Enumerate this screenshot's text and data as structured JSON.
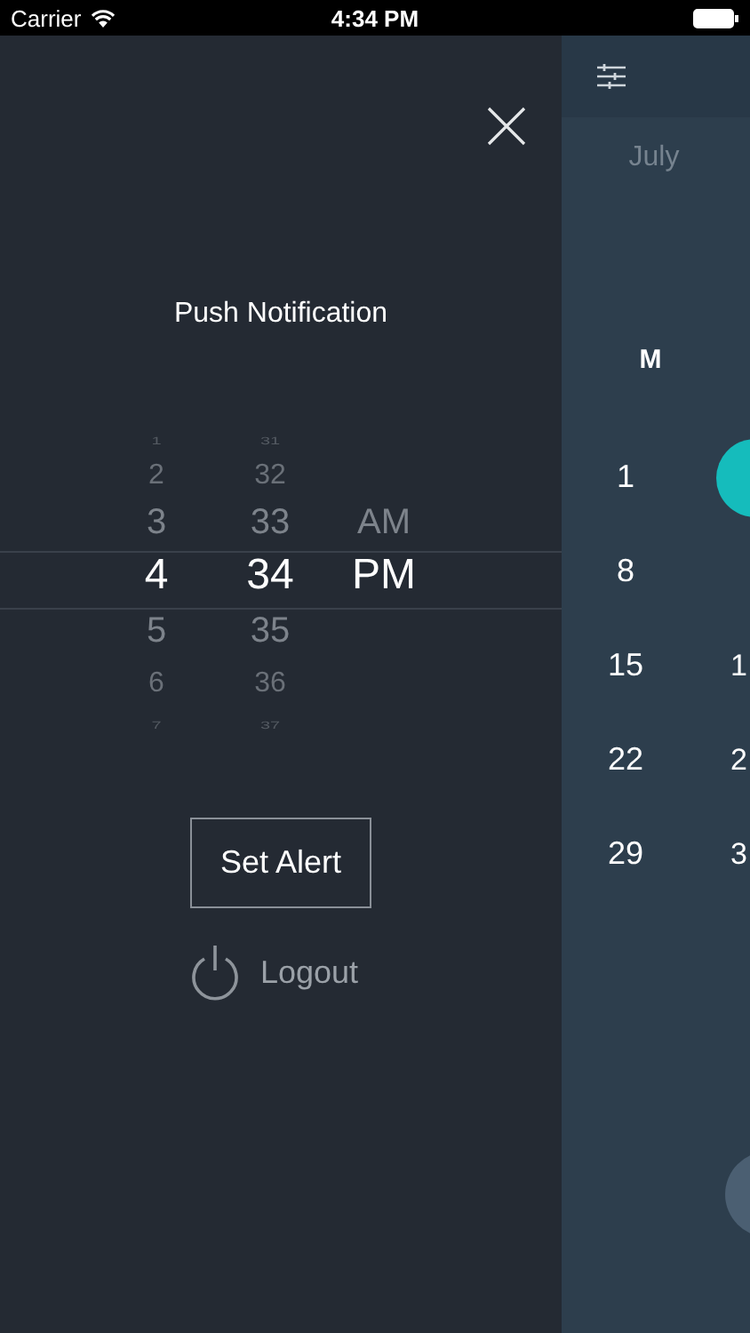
{
  "status_bar": {
    "carrier": "Carrier",
    "time": "4:34 PM"
  },
  "menu": {
    "title": "Push Notification",
    "picker": [
      {
        "items": [
          {
            "text": "1",
            "selected": false
          },
          {
            "text": "2",
            "selected": false
          },
          {
            "text": "3",
            "selected": false
          },
          {
            "text": "4",
            "selected": true
          },
          {
            "text": "5",
            "selected": false
          },
          {
            "text": "6",
            "selected": false
          },
          {
            "text": "7",
            "selected": false
          }
        ]
      },
      {
        "items": [
          {
            "text": "31",
            "selected": false
          },
          {
            "text": "32",
            "selected": false
          },
          {
            "text": "33",
            "selected": false
          },
          {
            "text": "34",
            "selected": true
          },
          {
            "text": "35",
            "selected": false
          },
          {
            "text": "36",
            "selected": false
          },
          {
            "text": "37",
            "selected": false
          }
        ]
      },
      {
        "items": [
          {
            "text": "AM",
            "selected": false
          },
          {
            "text": "PM",
            "selected": true
          }
        ]
      }
    ],
    "set_button": "Set Alert",
    "logout": "Logout"
  },
  "calendar": {
    "month": "July",
    "weekday": "M",
    "weeks": [
      {
        "cells": [
          {
            "text": "1",
            "selected": false
          },
          {
            "selected": true
          }
        ]
      },
      {
        "cells": [
          {
            "text": "8",
            "selected": false
          }
        ]
      },
      {
        "cells": [
          {
            "text": "15",
            "selected": false
          },
          {
            "text": "1",
            "selected": false
          }
        ]
      },
      {
        "cells": [
          {
            "text": "22",
            "selected": false
          },
          {
            "text": "2",
            "selected": false
          }
        ]
      },
      {
        "cells": [
          {
            "text": "29",
            "selected": false
          },
          {
            "text": "3",
            "selected": false
          }
        ]
      }
    ]
  }
}
